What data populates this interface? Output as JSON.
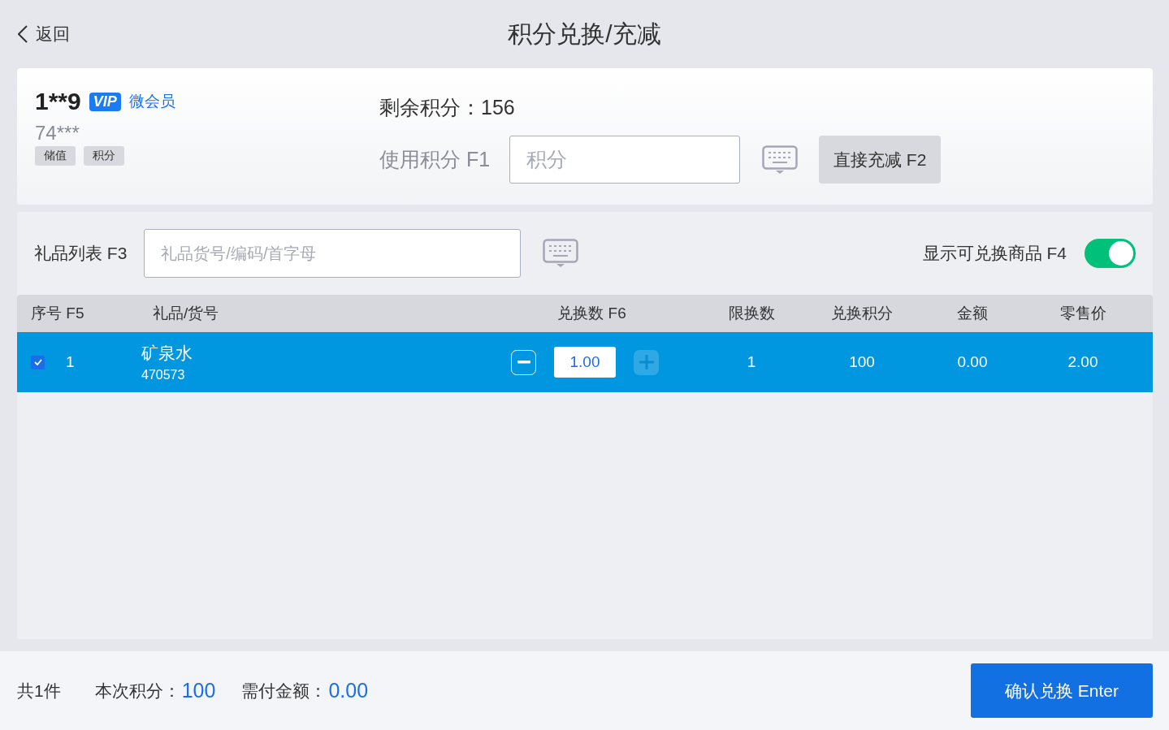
{
  "header": {
    "back_label": "返回",
    "title": "积分兑换/充减"
  },
  "member": {
    "name": "1**9",
    "vip_badge": "VIP",
    "level": "微会员",
    "card_no": "74***",
    "tags": [
      "储值",
      "积分"
    ]
  },
  "points": {
    "remaining_label": "剩余积分：",
    "remaining_value": "156",
    "use_label": "使用积分 F1",
    "use_placeholder": "积分",
    "direct_button": "直接充减 F2"
  },
  "gift_panel": {
    "label": "礼品列表 F3",
    "search_placeholder": "礼品货号/编码/首字母",
    "toggle_label": "显示可兑换商品 F4",
    "toggle_on": true
  },
  "table": {
    "columns": [
      "序号 F5",
      "礼品/货号",
      "兑换数 F6",
      "限换数",
      "兑换积分",
      "金额",
      "零售价"
    ],
    "rows": [
      {
        "selected": true,
        "checked": true,
        "index": "1",
        "name": "矿泉水",
        "code": "470573",
        "quantity": "1.00",
        "minus_disabled": false,
        "plus_disabled": true,
        "limit": "1",
        "points": "100",
        "amount": "0.00",
        "retail": "2.00"
      }
    ]
  },
  "footer": {
    "count": "共1件",
    "points_label": "本次积分：",
    "points_value": "100",
    "pay_label": "需付金额：",
    "pay_value": "0.00",
    "confirm_button": "确认兑换 Enter"
  }
}
